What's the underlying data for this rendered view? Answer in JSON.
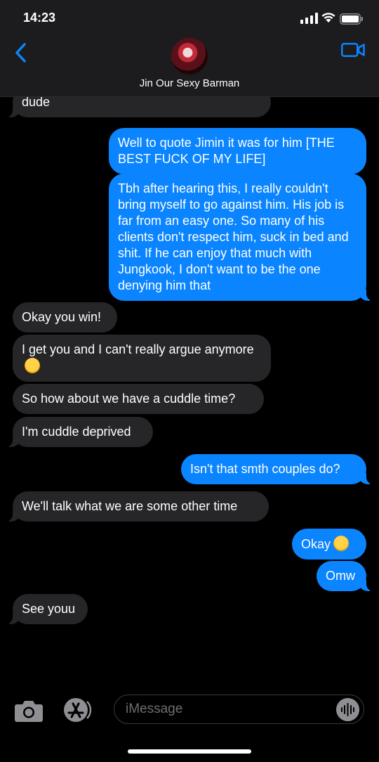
{
  "status_bar": {
    "time": "14:23"
  },
  "header": {
    "contact_name": "Jin Our Sexy Barman"
  },
  "messages": [
    {
      "from": "contact",
      "text": "dude"
    },
    {
      "from": "me",
      "text": "Well to quote Jimin it was for him [THE BEST FUCK OF MY LIFE]"
    },
    {
      "from": "me",
      "text": "Tbh after hearing this, I really couldn't bring myself to go against him. His job is far from an easy one. So many of his clients don't respect him, suck in bed and shit. If he can enjoy that much with Jungkook, I don't want to be the one denying him that"
    },
    {
      "from": "contact",
      "text": "Okay you win!"
    },
    {
      "from": "contact",
      "text": "I get you and I can't really argue anymore"
    },
    {
      "from": "contact",
      "text": "So how about we have a cuddle time?"
    },
    {
      "from": "contact",
      "text": "I'm cuddle deprived"
    },
    {
      "from": "me",
      "text": "Isn't that smth couples do?"
    },
    {
      "from": "contact",
      "text": "We'll talk what we are some other time"
    },
    {
      "from": "me",
      "text": "Okay"
    },
    {
      "from": "me",
      "text": "Omw"
    },
    {
      "from": "contact",
      "text": "See youu"
    }
  ],
  "input": {
    "placeholder": "iMessage",
    "value": ""
  },
  "colors": {
    "sent_bubble": "#0a84ff",
    "received_bubble": "#262628",
    "accent": "#0a84ff"
  }
}
